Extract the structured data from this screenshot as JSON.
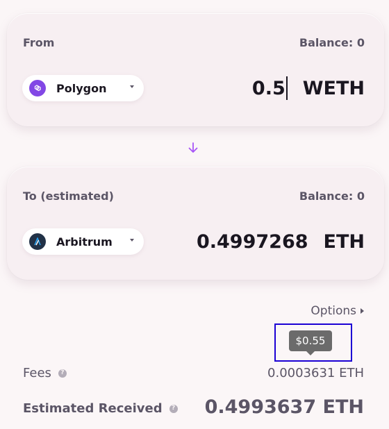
{
  "from_card": {
    "label": "From",
    "balance": "Balance: 0",
    "chain": "Polygon",
    "chain_icon": "polygon-icon",
    "amount": "0.5",
    "token": "WETH"
  },
  "to_card": {
    "label": "To (estimated)",
    "balance": "Balance: 0",
    "chain": "Arbitrum",
    "chain_icon": "arbitrum-icon",
    "amount": "0.4997268",
    "token": "ETH"
  },
  "options_label": "Options",
  "tooltip": "$0.55",
  "fees": {
    "label": "Fees",
    "value": "0.0003631 ETH"
  },
  "estimated_received": {
    "label": "Estimated Received",
    "value": "0.4993637 ETH"
  },
  "colors": {
    "accent": "#a855f7",
    "polygon": "#8247e5",
    "arbitrum": "#213147",
    "highlight": "#1b00d4",
    "tooltip_bg": "#6b6b6b"
  }
}
